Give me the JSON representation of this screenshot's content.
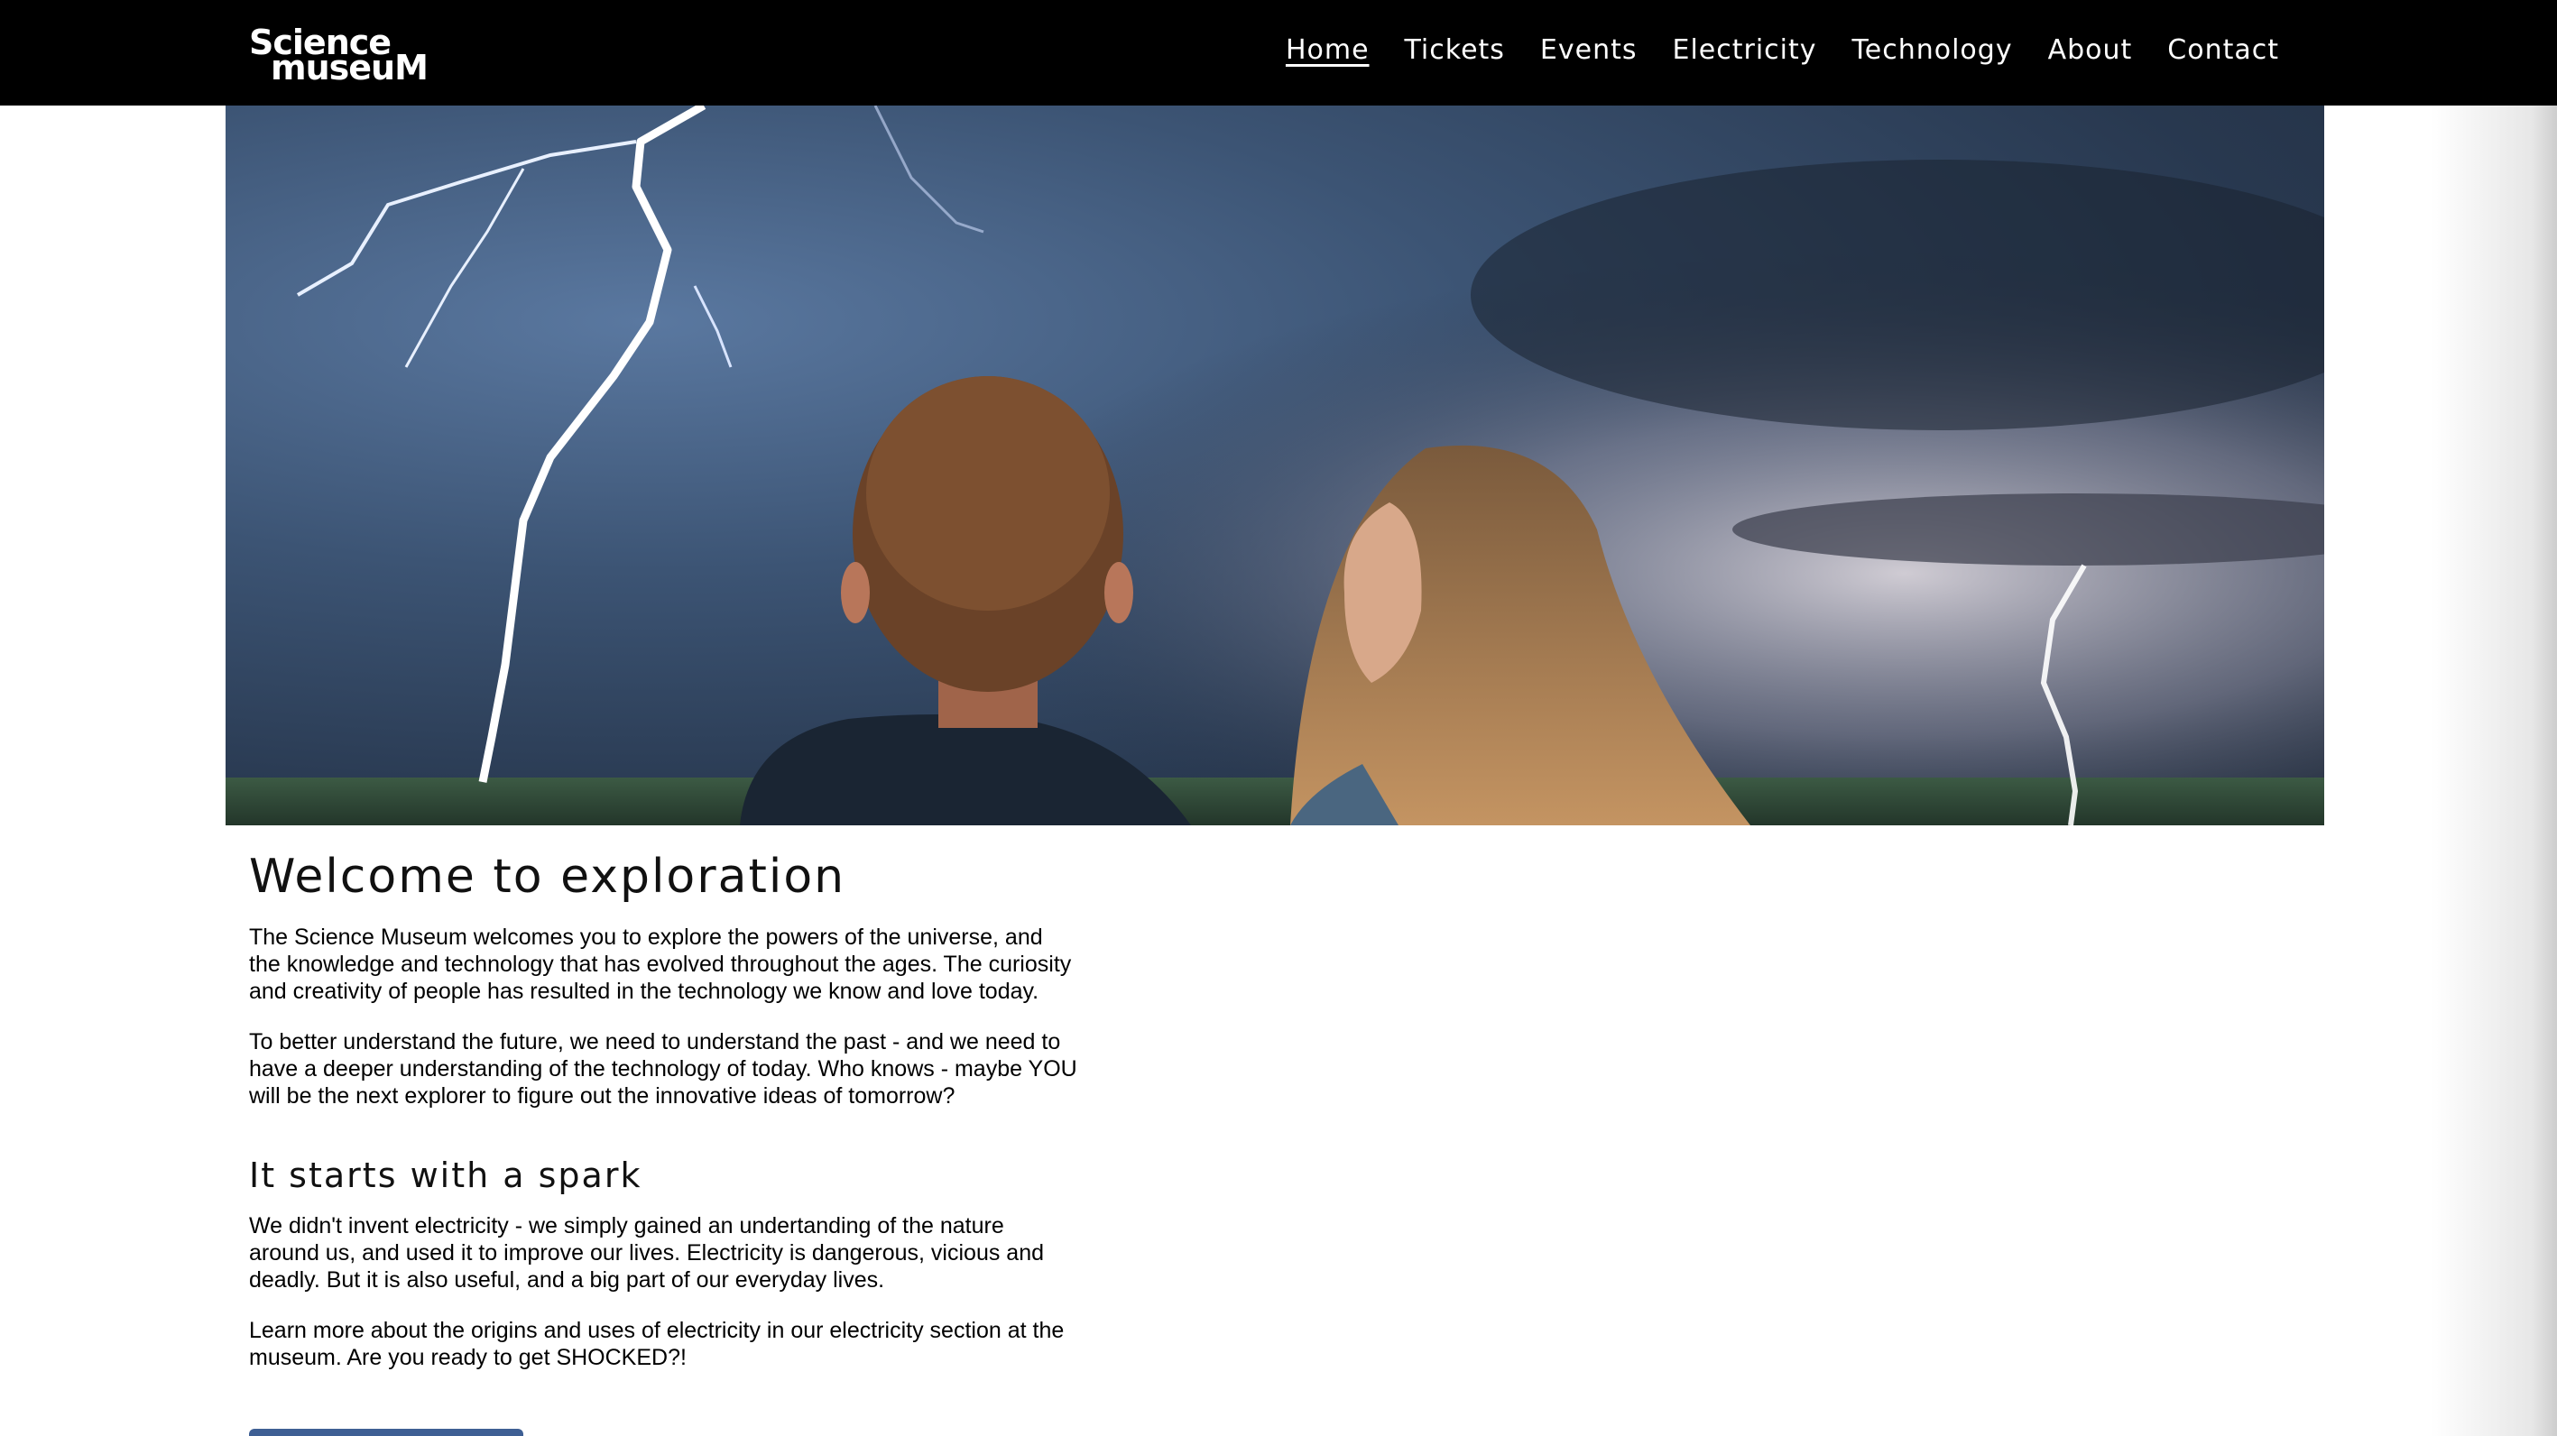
{
  "header": {
    "logo_line1": "Science",
    "logo_line2": "museuM",
    "nav": [
      {
        "label": "Home",
        "active": true
      },
      {
        "label": "Tickets"
      },
      {
        "label": "Events"
      },
      {
        "label": "Electricity"
      },
      {
        "label": "Technology"
      },
      {
        "label": "About"
      },
      {
        "label": "Contact"
      }
    ]
  },
  "main": {
    "welcome_title": "Welcome to exploration",
    "welcome_p1": "The Science Museum welcomes you to explore the powers of the universe, and the knowledge and technology that has evolved throughout the ages. The curiosity and creativity of people has resulted in the technology we know and love today.",
    "welcome_p2": "To better understand the future, we need to understand the past - and we need to have a deeper understanding of the technology of today. Who knows - maybe YOU will be the next explorer to figure out the innovative ideas of tomorrow?",
    "spark_title": "It starts with a spark",
    "spark_p1": "We didn't invent electricity - we simply gained an undertanding of the nature around us, and used it to improve our lives. Electricity is dangerous, vicious and deadly. But it is also useful, and a big part of our everyday lives.",
    "spark_p2": "Learn more about the origins and uses of electricity in our electricity section at the museum. Are you ready to get SHOCKED?!"
  },
  "colors": {
    "header_bg": "#000000",
    "cta_button": "#3e5f94"
  }
}
